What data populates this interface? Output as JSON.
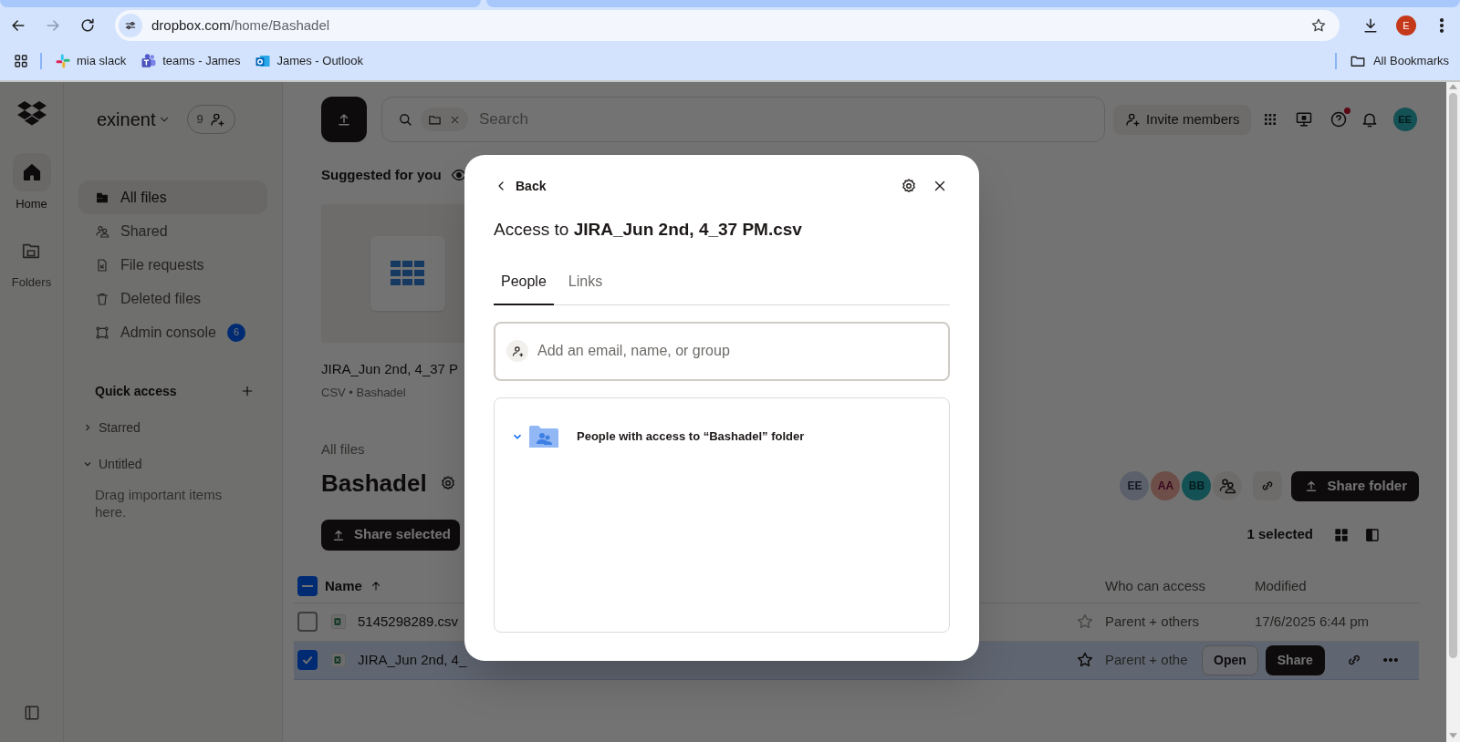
{
  "browser": {
    "url_host": "dropbox.com",
    "url_path": "/home/Bashadel",
    "profile": "E",
    "bookmarks": [
      {
        "label": "mia slack",
        "kind": "slack"
      },
      {
        "label": "teams - James",
        "kind": "teams"
      },
      {
        "label": "James - Outlook",
        "kind": "outlook"
      }
    ],
    "all_bookmarks": "All Bookmarks"
  },
  "rail": [
    {
      "label": "Home",
      "kind": "home",
      "selected": true
    },
    {
      "label": "Folders",
      "kind": "folders",
      "selected": false
    }
  ],
  "sidebar": {
    "team": "exinent",
    "member_count": "9",
    "items": [
      {
        "label": "All files",
        "kind": "files",
        "selected": true
      },
      {
        "label": "Shared",
        "kind": "shared",
        "selected": false
      },
      {
        "label": "File requests",
        "kind": "requests",
        "selected": false
      },
      {
        "label": "Deleted files",
        "kind": "deleted",
        "selected": false
      },
      {
        "label": "Admin console",
        "kind": "admin",
        "selected": false,
        "badge": "6"
      }
    ],
    "quick_access": "Quick access",
    "sections": [
      {
        "label": "Starred",
        "expanded": false
      },
      {
        "label": "Untitled",
        "expanded": true,
        "hint": "Drag important items here."
      }
    ]
  },
  "topbar": {
    "search_placeholder": "Search",
    "invite": "Invite members",
    "avatar": "EE"
  },
  "suggested": {
    "title": "Suggested for you",
    "cards": [
      {
        "name": "JIRA_Jun 2nd, 4_37 P",
        "meta": "CSV • Bashadel"
      }
    ]
  },
  "folder": {
    "breadcrumb": "All files",
    "title": "Bashadel",
    "share_selected": "Share selected",
    "members": [
      {
        "initials": "EE"
      },
      {
        "initials": "AA"
      },
      {
        "initials": "BB"
      }
    ],
    "share_folder": "Share folder",
    "selection_count": "1 selected"
  },
  "table": {
    "select_all_indeterminate": true,
    "columns": [
      "Name",
      "Who can access",
      "Modified"
    ],
    "rows": [
      {
        "name": "5145298289.csv",
        "access": "Parent + others",
        "modified": "17/6/2025 6:44 pm",
        "selected": false
      },
      {
        "name": "JIRA_Jun 2nd, 4_",
        "access": "Parent + othe",
        "selected": true,
        "actions": [
          "Open",
          "Share"
        ]
      }
    ]
  },
  "dialog": {
    "back": "Back",
    "title": "Access to **JIRA_Jun 2nd, 4_37 PM.csv**",
    "tabs": [
      {
        "label": "People",
        "selected": true
      },
      {
        "label": "Links",
        "selected": false
      }
    ],
    "input_placeholder": "Add an email, name, or group",
    "groups": [
      {
        "label": "People with access to “Bashadel” folder",
        "expanded": true
      }
    ]
  }
}
